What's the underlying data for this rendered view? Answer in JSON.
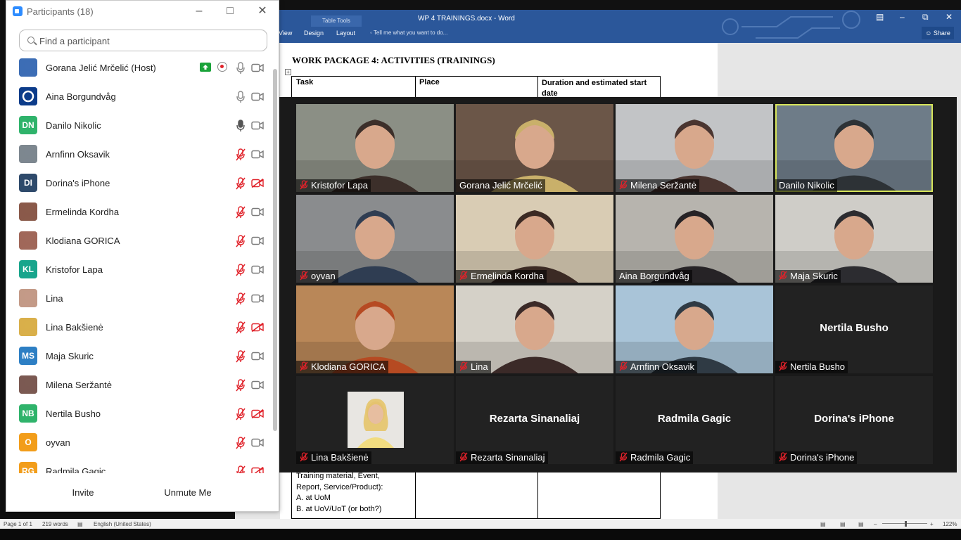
{
  "word": {
    "document_title": "WP 4 TRAININGS.docx - Word",
    "contextual_tab": "Table Tools",
    "tabs": [
      "View",
      "Design",
      "Layout"
    ],
    "tell_me": "Tell me what you want to do...",
    "share_label": "Share",
    "heading": "WORK PACKAGE 4: ACTIVITIES (TRAININGS)",
    "table_headers": [
      "Task",
      "Place",
      "Duration and estimated start date"
    ],
    "bottom_cell_lines": [
      "Training material, Event,",
      "Report, Service/Product):",
      "A. at UoM",
      "B. at UoV/UoT (or both?)"
    ],
    "status": {
      "page": "Page 1 of 1",
      "words": "219 words",
      "language": "English (United States)",
      "zoom": "122%"
    }
  },
  "participants_panel": {
    "title": "Participants (18)",
    "search_placeholder": "Find a participant",
    "invite_label": "Invite",
    "unmute_label": "Unmute Me",
    "participants": [
      {
        "name": "Gorana Jelić Mrčelić (Host)",
        "avatar": "photo",
        "color": "#3d6db5",
        "mic": "on",
        "camera": "on",
        "share": true,
        "recording": true
      },
      {
        "name": "Aina Borgundvåg",
        "avatar": "logo",
        "color": "#0c3c8a",
        "mic": "on",
        "camera": "on"
      },
      {
        "name": "Danilo Nikolic",
        "avatar": "DN",
        "color": "#2fb36b",
        "mic": "active",
        "camera": "on"
      },
      {
        "name": "Arnfinn Oksavik",
        "avatar": "photo",
        "color": "#7d8790",
        "mic": "muted",
        "camera": "on"
      },
      {
        "name": "Dorina's iPhone",
        "avatar": "DI",
        "color": "#2e4a6b",
        "mic": "muted",
        "camera": "off"
      },
      {
        "name": "Ermelinda Kordha",
        "avatar": "photo",
        "color": "#8a5a4a",
        "mic": "muted",
        "camera": "on"
      },
      {
        "name": "Klodiana GORICA",
        "avatar": "photo",
        "color": "#a0685a",
        "mic": "muted",
        "camera": "on"
      },
      {
        "name": "Kristofor Lapa",
        "avatar": "KL",
        "color": "#18a58c",
        "mic": "muted",
        "camera": "on"
      },
      {
        "name": "Lina",
        "avatar": "photo",
        "color": "#c49a88",
        "mic": "muted",
        "camera": "on"
      },
      {
        "name": "Lina Bakšienė",
        "avatar": "photo",
        "color": "#d9b04a",
        "mic": "muted",
        "camera": "off"
      },
      {
        "name": "Maja Skuric",
        "avatar": "MS",
        "color": "#2d7fc4",
        "mic": "muted",
        "camera": "on"
      },
      {
        "name": "Milena Seržantė",
        "avatar": "photo",
        "color": "#7b5a52",
        "mic": "muted",
        "camera": "on"
      },
      {
        "name": "Nertila Busho",
        "avatar": "NB",
        "color": "#2fb36b",
        "mic": "muted",
        "camera": "off"
      },
      {
        "name": "oyvan",
        "avatar": "O",
        "color": "#f29d1a",
        "mic": "muted",
        "camera": "on"
      },
      {
        "name": "Radmila Gagic",
        "avatar": "RG",
        "color": "#f29d1a",
        "mic": "muted",
        "camera": "off"
      }
    ]
  },
  "gallery": {
    "tiles": [
      {
        "name": "Kristofor Lapa",
        "muted": true,
        "video": true,
        "bg": "#8b8f85",
        "fg": "#3c2f2a"
      },
      {
        "name": "Gorana Jelić Mrčelić",
        "muted": false,
        "video": true,
        "bg": "#6b5648",
        "fg": "#c9b06a"
      },
      {
        "name": "Milena Seržantė",
        "muted": true,
        "video": true,
        "bg": "#c2c4c6",
        "fg": "#4a3530"
      },
      {
        "name": "Danilo Nikolic",
        "muted": false,
        "video": true,
        "active": true,
        "bg": "#6e7c88",
        "fg": "#2d3236"
      },
      {
        "name": "oyvan",
        "muted": true,
        "video": true,
        "bg": "#8a8c8e",
        "fg": "#2f3d52"
      },
      {
        "name": "Ermelinda Kordha",
        "muted": true,
        "video": true,
        "bg": "#d9ccb4",
        "fg": "#3b2a24"
      },
      {
        "name": "Aina Borgundvåg",
        "muted": false,
        "video": true,
        "bg": "#b7b4ae",
        "fg": "#262326"
      },
      {
        "name": "Maja Skuric",
        "muted": true,
        "video": true,
        "bg": "#cfcdc8",
        "fg": "#2c2c30"
      },
      {
        "name": "Klodiana GORICA",
        "muted": true,
        "video": true,
        "bg": "#b98758",
        "fg": "#b64a22"
      },
      {
        "name": "Lina",
        "muted": true,
        "video": true,
        "bg": "#d5d1c8",
        "fg": "#3b2a28"
      },
      {
        "name": "Arnfinn Oksavik",
        "muted": true,
        "video": true,
        "bg": "#a9c4d8",
        "fg": "#2f3a44"
      },
      {
        "name": "Nertila Busho",
        "muted": true,
        "video": false
      },
      {
        "name": "Lina Bakšienė",
        "muted": true,
        "video": false,
        "photo": true
      },
      {
        "name": "Rezarta Sinanaliaj",
        "muted": true,
        "video": false
      },
      {
        "name": "Radmila Gagic",
        "muted": true,
        "video": false
      },
      {
        "name": "Dorina's iPhone",
        "muted": true,
        "video": false
      }
    ]
  }
}
